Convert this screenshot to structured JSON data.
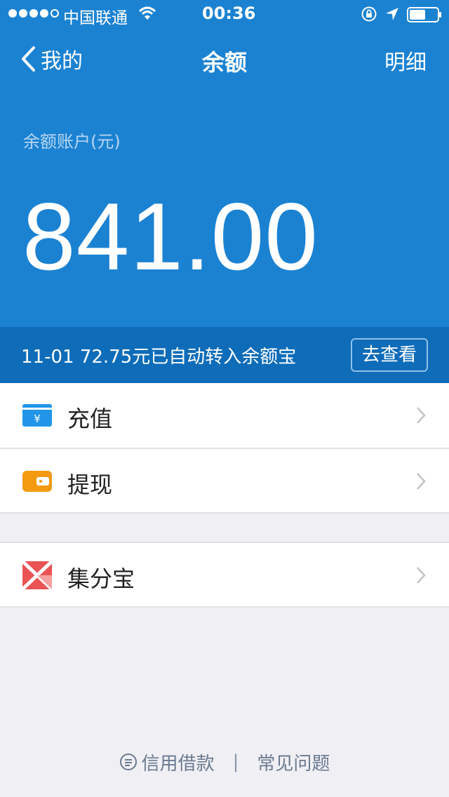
{
  "status_bar": {
    "carrier": "中国联通",
    "time": "00:36"
  },
  "nav": {
    "back_label": "我的",
    "title": "余额",
    "right_label": "明细"
  },
  "balance": {
    "label": "余额账户(元)",
    "amount": "841.00"
  },
  "notice": {
    "text": "11-01 72.75元已自动转入余额宝",
    "button_label": "去查看"
  },
  "menu": {
    "recharge_label": "充值",
    "withdraw_label": "提现",
    "points_label": "集分宝"
  },
  "footer": {
    "credit_label": "信用借款",
    "separator": "|",
    "faq_label": "常见问题"
  },
  "colors": {
    "header_blue": "#1b82d2",
    "notice_blue": "#0e6cb9",
    "recharge_icon": "#2196e8",
    "withdraw_icon": "#f39a11",
    "points_icon": "#ea5455"
  }
}
